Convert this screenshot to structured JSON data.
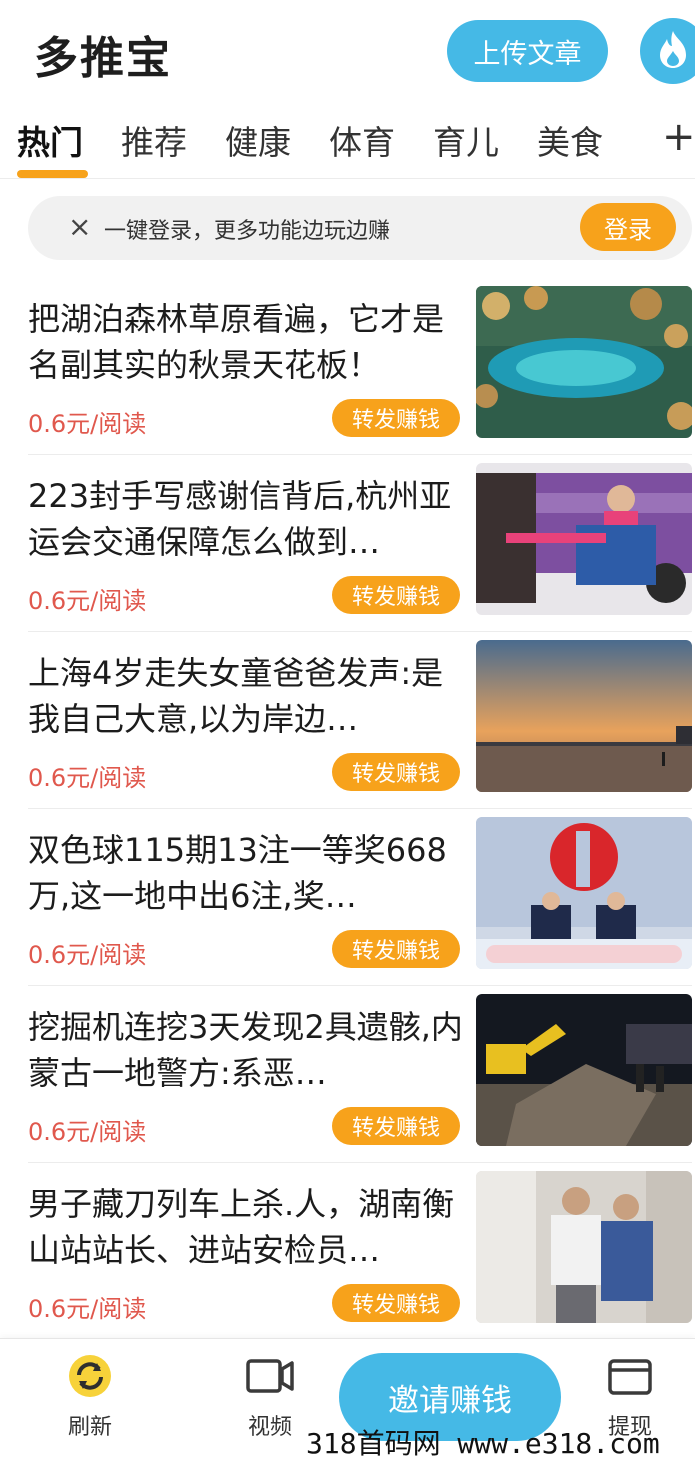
{
  "header": {
    "app_title": "多推宝",
    "upload_label": "上传文章",
    "flame_icon": "flame-icon"
  },
  "tabs": [
    {
      "label": "热门",
      "active": true
    },
    {
      "label": "推荐",
      "active": false
    },
    {
      "label": "健康",
      "active": false
    },
    {
      "label": "体育",
      "active": false
    },
    {
      "label": "育儿",
      "active": false
    },
    {
      "label": "美食",
      "active": false
    }
  ],
  "tabs_add_label": "+",
  "login_banner": {
    "close_label": "×",
    "text": "一键登录，更多功能边玩边赚",
    "login_label": "登录"
  },
  "articles": [
    {
      "title": "把湖泊森林草原看遍，它才是名副其实的秋景天花板！",
      "price": "0.6元/阅读",
      "share_label": "转发赚钱",
      "thumb": "lake-forest-photo"
    },
    {
      "title": "223封手写感谢信背后,杭州亚运会交通保障怎么做到…",
      "price": "0.6元/阅读",
      "share_label": "转发赚钱",
      "thumb": "bus-volunteer-photo"
    },
    {
      "title": "上海4岁走失女童爸爸发声:是我自己大意,以为岸边…",
      "price": "0.6元/阅读",
      "share_label": "转发赚钱",
      "thumb": "sunset-beach-photo"
    },
    {
      "title": "双色球115期13注一等奖668万,这一地中出6注,奖…",
      "price": "0.6元/阅读",
      "share_label": "转发赚钱",
      "thumb": "lottery-draw-photo"
    },
    {
      "title": "挖掘机连挖3天发现2具遗骸,内蒙古一地警方:系恶…",
      "price": "0.6元/阅读",
      "share_label": "转发赚钱",
      "thumb": "excavator-night-photo"
    },
    {
      "title": "男子藏刀列车上杀.人，湖南衡山站站长、进站安检员…",
      "price": "0.6元/阅读",
      "share_label": "转发赚钱",
      "thumb": "police-photo"
    }
  ],
  "bottom_nav": {
    "refresh_label": "刷新",
    "video_label": "视频",
    "invite_label": "邀请赚钱",
    "withdraw_label": "提现"
  },
  "watermark": "318首码网 www.e318.com",
  "colors": {
    "accent_blue": "#45b9e6",
    "accent_orange": "#f7a21b",
    "price_red": "#e0584d"
  }
}
